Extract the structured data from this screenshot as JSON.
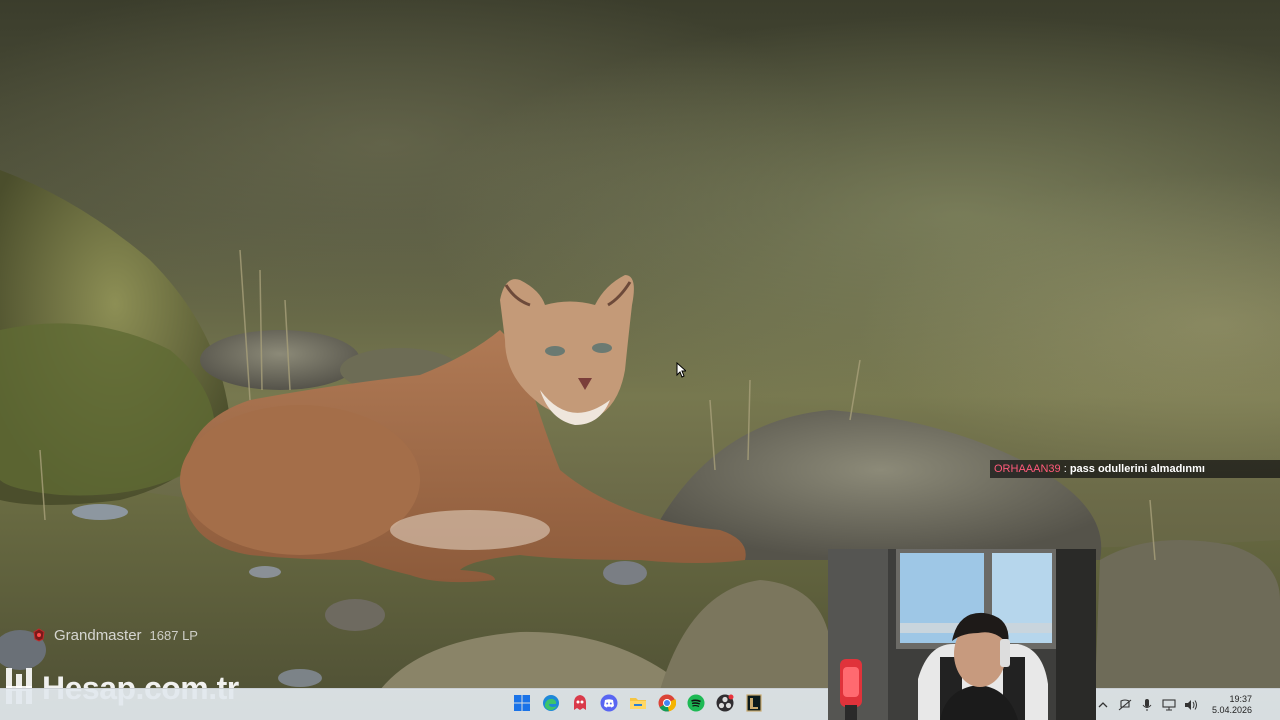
{
  "chat": {
    "username": "ORHAAAN39",
    "separator": " : ",
    "message": "pass odullerini almadınmı"
  },
  "overlay": {
    "rank_name": "Grandmaster",
    "rank_lp": "1687 LP"
  },
  "watermark": {
    "text": "Hesap.com.tr"
  },
  "taskbar": {
    "apps": [
      {
        "name": "start-button",
        "icon": "windows-icon"
      },
      {
        "name": "edge",
        "icon": "edge-icon"
      },
      {
        "name": "app-red",
        "icon": "red-app-icon"
      },
      {
        "name": "discord",
        "icon": "discord-icon"
      },
      {
        "name": "file-explorer",
        "icon": "folder-icon"
      },
      {
        "name": "chrome",
        "icon": "chrome-icon"
      },
      {
        "name": "spotify",
        "icon": "spotify-icon"
      },
      {
        "name": "obs",
        "icon": "obs-icon"
      },
      {
        "name": "league-client",
        "icon": "league-icon"
      }
    ],
    "clock_time": "19:37",
    "clock_date": "5.04.2026"
  },
  "colors": {
    "taskbar_bg": "#e2e8ee",
    "chat_username": "#ff5a7a"
  }
}
